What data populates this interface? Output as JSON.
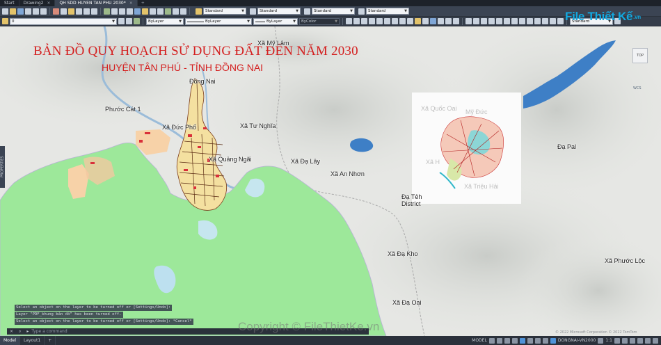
{
  "tabs": [
    {
      "label": "Start",
      "active": false
    },
    {
      "label": "Drawing2",
      "active": false
    },
    {
      "label": "QH SDD HUYEN TAN PHU 2030*",
      "active": true
    }
  ],
  "toolbar": {
    "text_style": "Standard",
    "dim_style": "Standard",
    "table_style": "Standard",
    "mleader_style": "Standard",
    "layer": "0",
    "color": "ByLayer",
    "linetype": "ByLayer",
    "lineweight": "ByLayer",
    "plotstyle": "ByColor",
    "visual_style": "Standard"
  },
  "map": {
    "title": "BẢN ĐỒ QUY HOẠCH SỬ DỤNG ĐẤT ĐẾN NĂM 2030",
    "subtitle": "HUYỆN TÂN PHÚ - TỈNH ĐỒNG NAI",
    "places": {
      "xa_my_lam": "Xã Mỹ Lâm",
      "dong_nai": "Đồng Nai",
      "phuoc_cat_1": "Phước Cát 1",
      "xa_duc_pho": "Xã Đức Phổ",
      "xa_tu_nghia": "Xã Tư Nghĩa",
      "xa_quang_ngai": "Xã Quảng Ngãi",
      "xa_da_lay": "Xã Đạ Lây",
      "xa_an_nhon": "Xã An Nhơn",
      "da_teh_district": "Đạ Tẻh District",
      "xa_da_kho": "Xã Đạ Kho",
      "xa_da_oai": "Xã Đạ Oai",
      "da_pal": "Đạ Pal",
      "xa_phuoc_loc": "Xã Phước Lộc"
    },
    "inset_places": {
      "xa_quoc_oai": "Xã Quốc Oai",
      "my_duc": "Mỹ Đức",
      "xa_ha": "Xã H",
      "xa_trieu_hai": "Xã Triệu Hải"
    },
    "viewcube_label": "TOP",
    "wcs_label": "WCS",
    "copyright": "Copyright © FileThietKe.vn",
    "attribution": "© 2022 Microsoft Corporation © 2022 TomTom"
  },
  "logo": {
    "text": "File Thiết Kế",
    "sub": ".vn"
  },
  "side_palette": "PROPERTIES",
  "command": {
    "history": [
      "Select an object on the layer to be turned off or [Settings/Undo]:",
      "Layer \"PDF_khung bản đồ\" has been turned off.",
      "Select an object on the layer to be turned off or [Settings/Undo]: *Cancel*"
    ],
    "placeholder": "Type a command"
  },
  "status": {
    "layout_tabs": [
      "Model",
      "Layout1"
    ],
    "mode": "MODEL",
    "coordinate_system": "DONGNAI-VN2000",
    "scale": "1:1"
  }
}
